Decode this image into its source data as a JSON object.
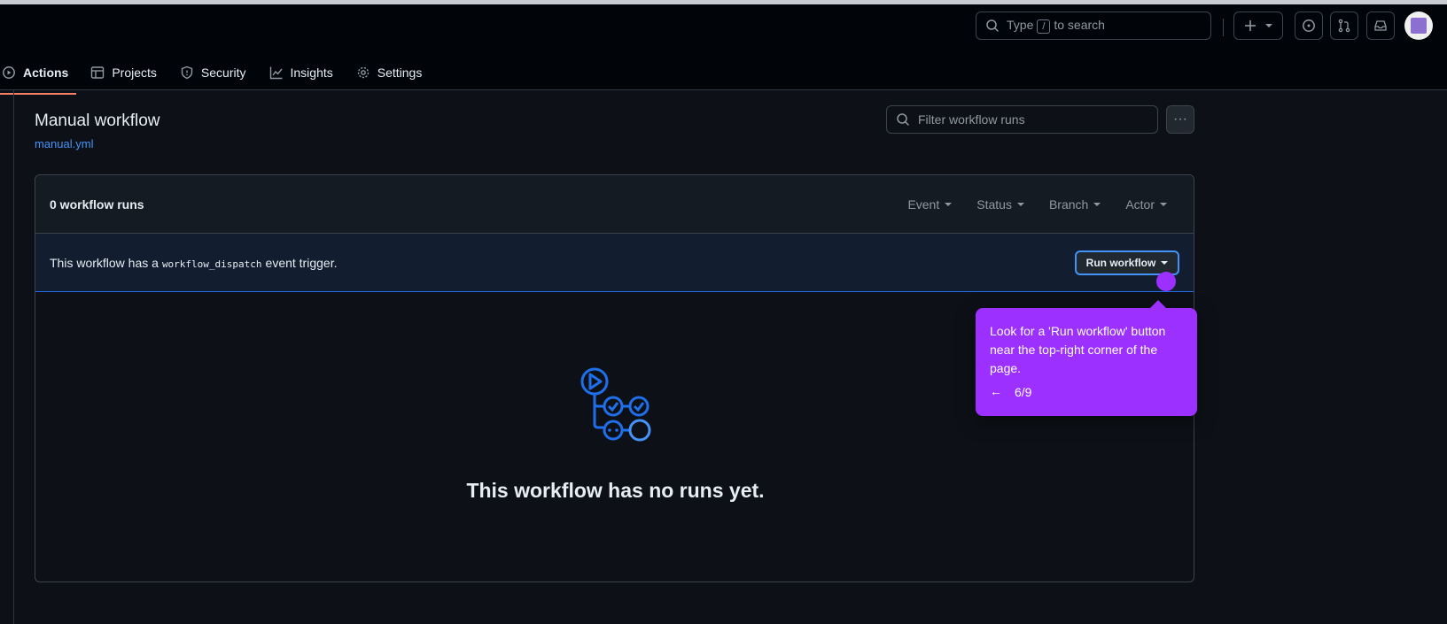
{
  "header": {
    "search_text_before": "Type",
    "search_key": "/",
    "search_text_after": "to search",
    "create_icon": "plus-icon",
    "issues_icon": "issue-opened-icon",
    "pulls_icon": "git-pull-request-icon",
    "inbox_icon": "inbox-icon"
  },
  "tabs": [
    {
      "label": "Actions",
      "icon": "play-icon",
      "active": true
    },
    {
      "label": "Projects",
      "icon": "table-icon"
    },
    {
      "label": "Security",
      "icon": "shield-icon"
    },
    {
      "label": "Insights",
      "icon": "graph-icon"
    },
    {
      "label": "Settings",
      "icon": "gear-icon"
    }
  ],
  "page": {
    "title": "Manual workflow",
    "file": "manual.yml",
    "filter_placeholder": "Filter workflow runs",
    "more_label": "···"
  },
  "panel": {
    "runs_count": "0 workflow runs",
    "filters": [
      "Event",
      "Status",
      "Branch",
      "Actor"
    ],
    "banner_before": "This workflow has a",
    "banner_code": "workflow_dispatch",
    "banner_after": "event trigger.",
    "run_button": "Run workflow",
    "empty_title": "This workflow has no runs yet."
  },
  "tooltip": {
    "text": "Look for a 'Run workflow' button near the top-right corner of the page.",
    "back_arrow": "←",
    "step": "6/9"
  },
  "colors": {
    "accent_blue": "#4493f8",
    "tooltip_purple": "#9b30ff",
    "active_tab_underline": "#f78166"
  }
}
